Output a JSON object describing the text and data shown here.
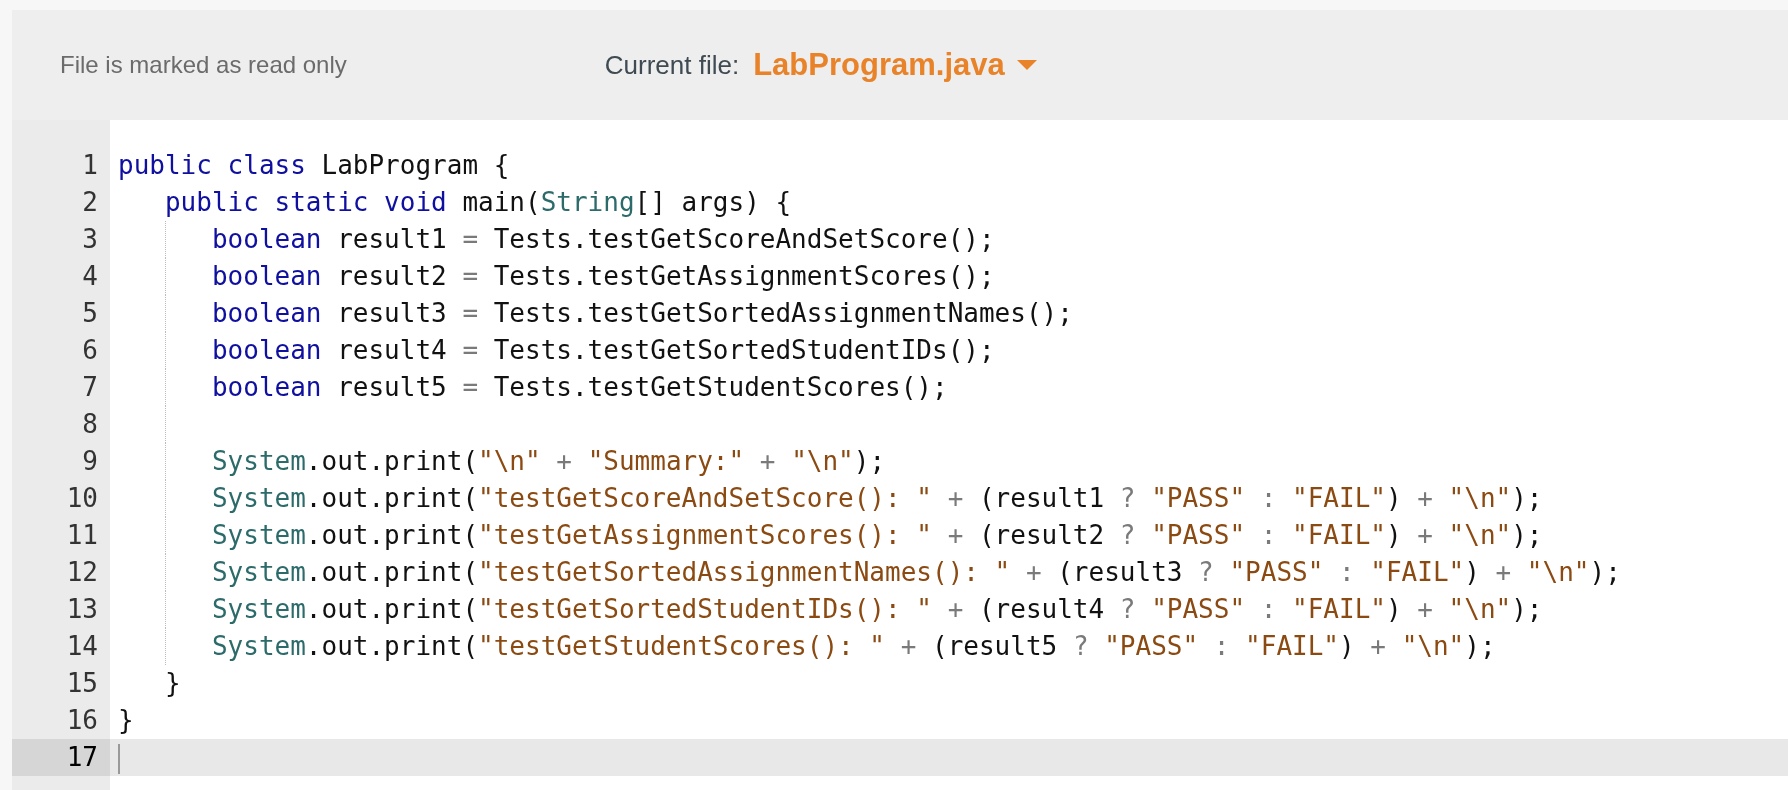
{
  "header": {
    "status": "File is marked as read only",
    "current_file_label": "Current file:",
    "current_file": "LabProgram.java"
  },
  "editor": {
    "lines": [
      {
        "number": "1",
        "current": false,
        "tokens": [
          {
            "kind": "keyword",
            "text": "public class"
          },
          {
            "kind": "plain",
            "text": " LabProgram {"
          }
        ]
      },
      {
        "number": "2",
        "current": false,
        "tokens": [
          {
            "kind": "keyword",
            "text": "   public static void"
          },
          {
            "kind": "plain",
            "text": " main("
          },
          {
            "kind": "type",
            "text": "String"
          },
          {
            "kind": "plain",
            "text": "[] args) {"
          }
        ]
      },
      {
        "number": "3",
        "current": false,
        "tokens": [
          {
            "kind": "keyword",
            "text": "      boolean"
          },
          {
            "kind": "plain",
            "text": " result1"
          },
          {
            "kind": "operator",
            "text": " = "
          },
          {
            "kind": "plain",
            "text": "Tests.testGetScoreAndSetScore();"
          }
        ]
      },
      {
        "number": "4",
        "current": false,
        "tokens": [
          {
            "kind": "keyword",
            "text": "      boolean"
          },
          {
            "kind": "plain",
            "text": " result2"
          },
          {
            "kind": "operator",
            "text": " = "
          },
          {
            "kind": "plain",
            "text": "Tests.testGetAssignmentScores();"
          }
        ]
      },
      {
        "number": "5",
        "current": false,
        "tokens": [
          {
            "kind": "keyword",
            "text": "      boolean"
          },
          {
            "kind": "plain",
            "text": " result3"
          },
          {
            "kind": "operator",
            "text": " = "
          },
          {
            "kind": "plain",
            "text": "Tests.testGetSortedAssignmentNames();"
          }
        ]
      },
      {
        "number": "6",
        "current": false,
        "tokens": [
          {
            "kind": "keyword",
            "text": "      boolean"
          },
          {
            "kind": "plain",
            "text": " result4"
          },
          {
            "kind": "operator",
            "text": " = "
          },
          {
            "kind": "plain",
            "text": "Tests.testGetSortedStudentIDs();"
          }
        ]
      },
      {
        "number": "7",
        "current": false,
        "tokens": [
          {
            "kind": "keyword",
            "text": "      boolean"
          },
          {
            "kind": "plain",
            "text": " result5"
          },
          {
            "kind": "operator",
            "text": " = "
          },
          {
            "kind": "plain",
            "text": "Tests.testGetStudentScores();"
          }
        ]
      },
      {
        "number": "8",
        "current": false
      },
      {
        "number": "9",
        "current": false,
        "tokens": [
          {
            "kind": "type",
            "text": "      System"
          },
          {
            "kind": "plain",
            "text": ".out.print("
          },
          {
            "kind": "string",
            "text": "\"\\n\""
          },
          {
            "kind": "operator",
            "text": " + "
          },
          {
            "kind": "string",
            "text": "\"Summary:\""
          },
          {
            "kind": "operator",
            "text": " + "
          },
          {
            "kind": "string",
            "text": "\"\\n\""
          },
          {
            "kind": "plain",
            "text": ");"
          }
        ]
      },
      {
        "number": "10",
        "current": false,
        "tokens": [
          {
            "kind": "type",
            "text": "      System"
          },
          {
            "kind": "plain",
            "text": ".out.print("
          },
          {
            "kind": "string",
            "text": "\"testGetScoreAndSetScore(): \""
          },
          {
            "kind": "operator",
            "text": " + "
          },
          {
            "kind": "plain",
            "text": "(result1"
          },
          {
            "kind": "operator",
            "text": " ? "
          },
          {
            "kind": "string",
            "text": "\"PASS\""
          },
          {
            "kind": "operator",
            "text": " : "
          },
          {
            "kind": "string",
            "text": "\"FAIL\""
          },
          {
            "kind": "plain",
            "text": ")"
          },
          {
            "kind": "operator",
            "text": " + "
          },
          {
            "kind": "string",
            "text": "\"\\n\""
          },
          {
            "kind": "plain",
            "text": ");"
          }
        ]
      },
      {
        "number": "11",
        "current": false,
        "tokens": [
          {
            "kind": "type",
            "text": "      System"
          },
          {
            "kind": "plain",
            "text": ".out.print("
          },
          {
            "kind": "string",
            "text": "\"testGetAssignmentScores(): \""
          },
          {
            "kind": "operator",
            "text": " + "
          },
          {
            "kind": "plain",
            "text": "(result2"
          },
          {
            "kind": "operator",
            "text": " ? "
          },
          {
            "kind": "string",
            "text": "\"PASS\""
          },
          {
            "kind": "operator",
            "text": " : "
          },
          {
            "kind": "string",
            "text": "\"FAIL\""
          },
          {
            "kind": "plain",
            "text": ")"
          },
          {
            "kind": "operator",
            "text": " + "
          },
          {
            "kind": "string",
            "text": "\"\\n\""
          },
          {
            "kind": "plain",
            "text": ");"
          }
        ]
      },
      {
        "number": "12",
        "current": false,
        "tokens": [
          {
            "kind": "type",
            "text": "      System"
          },
          {
            "kind": "plain",
            "text": ".out.print("
          },
          {
            "kind": "string",
            "text": "\"testGetSortedAssignmentNames(): \""
          },
          {
            "kind": "operator",
            "text": " + "
          },
          {
            "kind": "plain",
            "text": "(result3"
          },
          {
            "kind": "operator",
            "text": " ? "
          },
          {
            "kind": "string",
            "text": "\"PASS\""
          },
          {
            "kind": "operator",
            "text": " : "
          },
          {
            "kind": "string",
            "text": "\"FAIL\""
          },
          {
            "kind": "plain",
            "text": ")"
          },
          {
            "kind": "operator",
            "text": " + "
          },
          {
            "kind": "string",
            "text": "\"\\n\""
          },
          {
            "kind": "plain",
            "text": ");"
          }
        ]
      },
      {
        "number": "13",
        "current": false,
        "tokens": [
          {
            "kind": "type",
            "text": "      System"
          },
          {
            "kind": "plain",
            "text": ".out.print("
          },
          {
            "kind": "string",
            "text": "\"testGetSortedStudentIDs(): \""
          },
          {
            "kind": "operator",
            "text": " + "
          },
          {
            "kind": "plain",
            "text": "(result4"
          },
          {
            "kind": "operator",
            "text": " ? "
          },
          {
            "kind": "string",
            "text": "\"PASS\""
          },
          {
            "kind": "operator",
            "text": " : "
          },
          {
            "kind": "string",
            "text": "\"FAIL\""
          },
          {
            "kind": "plain",
            "text": ")"
          },
          {
            "kind": "operator",
            "text": " + "
          },
          {
            "kind": "string",
            "text": "\"\\n\""
          },
          {
            "kind": "plain",
            "text": ");"
          }
        ]
      },
      {
        "number": "14",
        "current": false,
        "tokens": [
          {
            "kind": "type",
            "text": "      System"
          },
          {
            "kind": "plain",
            "text": ".out.print("
          },
          {
            "kind": "string",
            "text": "\"testGetStudentScores(): \""
          },
          {
            "kind": "operator",
            "text": " + "
          },
          {
            "kind": "plain",
            "text": "(result5"
          },
          {
            "kind": "operator",
            "text": " ? "
          },
          {
            "kind": "string",
            "text": "\"PASS\""
          },
          {
            "kind": "operator",
            "text": " : "
          },
          {
            "kind": "string",
            "text": "\"FAIL\""
          },
          {
            "kind": "plain",
            "text": ")"
          },
          {
            "kind": "operator",
            "text": " + "
          },
          {
            "kind": "string",
            "text": "\"\\n\""
          },
          {
            "kind": "plain",
            "text": ");"
          }
        ]
      },
      {
        "number": "15",
        "current": false,
        "tokens": [
          {
            "kind": "plain",
            "text": "   }"
          }
        ]
      },
      {
        "number": "16",
        "current": false,
        "tokens": [
          {
            "kind": "plain",
            "text": "}"
          }
        ]
      },
      {
        "number": "17",
        "current": true
      }
    ]
  }
}
